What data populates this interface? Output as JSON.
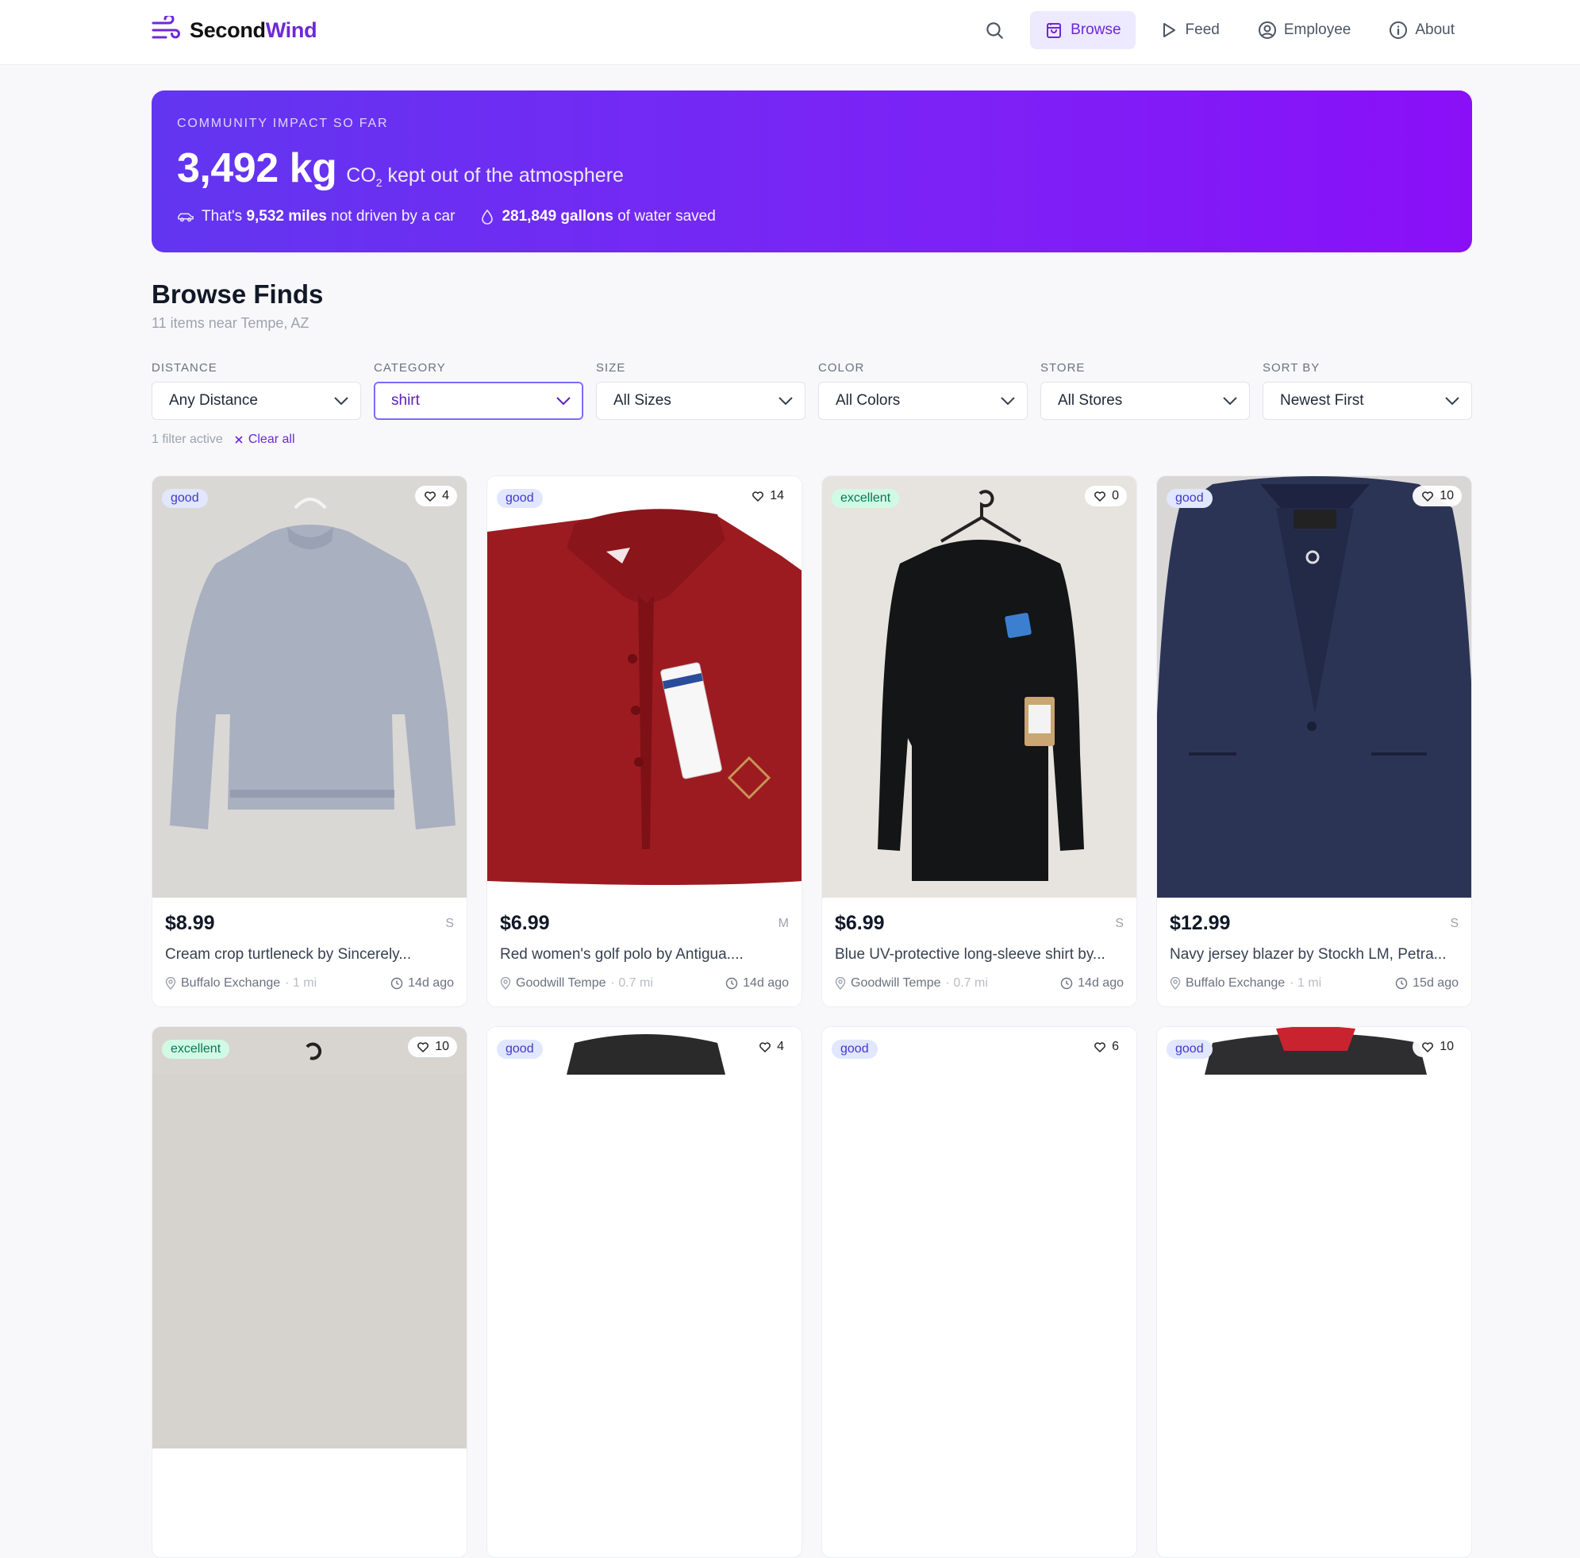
{
  "brand": {
    "name_part1": "Second",
    "name_part2": "Wind"
  },
  "nav": {
    "items": [
      {
        "label": "Browse",
        "icon": "shopping-bag-icon",
        "active": true
      },
      {
        "label": "Feed",
        "icon": "play-icon"
      },
      {
        "label": "Employee",
        "icon": "user-circle-icon"
      },
      {
        "label": "About",
        "icon": "info-icon"
      }
    ]
  },
  "impact": {
    "kicker": "COMMUNITY IMPACT SO FAR",
    "amount": "3,492 kg",
    "co2_prefix": "CO",
    "co2_sub": "2",
    "co2_suffix": " kept out of the atmosphere",
    "miles_prefix": "That's ",
    "miles_value": "9,532 miles",
    "miles_suffix": " not driven by a car",
    "water_value": "281,849 gallons",
    "water_suffix": " of water saved"
  },
  "heading": {
    "title": "Browse Finds",
    "count": "11 items near Tempe, AZ"
  },
  "filters": [
    {
      "label": "DISTANCE",
      "value": "Any Distance",
      "active": false
    },
    {
      "label": "CATEGORY",
      "value": "shirt",
      "active": true
    },
    {
      "label": "SIZE",
      "value": "All Sizes",
      "active": false
    },
    {
      "label": "COLOR",
      "value": "All Colors",
      "active": false
    },
    {
      "label": "STORE",
      "value": "All Stores",
      "active": false
    },
    {
      "label": "SORT BY",
      "value": "Newest First",
      "active": false
    }
  ],
  "filter_meta": {
    "active_text": "1 filter active",
    "clear_label": "Clear all"
  },
  "items": [
    {
      "condition": "good",
      "likes": "4",
      "price": "$8.99",
      "size": "S",
      "title": "Cream crop turtleneck by Sincerely...",
      "store": "Buffalo Exchange",
      "distance": "· 1 mi",
      "time": "14d ago"
    },
    {
      "condition": "good",
      "likes": "14",
      "price": "$6.99",
      "size": "M",
      "title": "Red women's golf polo by Antigua....",
      "store": "Goodwill Tempe",
      "distance": "· 0.7 mi",
      "time": "14d ago"
    },
    {
      "condition": "excellent",
      "likes": "0",
      "price": "$6.99",
      "size": "S",
      "title": "Blue UV-protective long-sleeve shirt by...",
      "store": "Goodwill Tempe",
      "distance": "· 0.7 mi",
      "time": "14d ago"
    },
    {
      "condition": "good",
      "likes": "10",
      "price": "$12.99",
      "size": "S",
      "title": "Navy jersey blazer by Stockh LM, Petra...",
      "store": "Buffalo Exchange",
      "distance": "· 1 mi",
      "time": "15d ago"
    },
    {
      "condition": "excellent",
      "likes": "10"
    },
    {
      "condition": "good",
      "likes": "4"
    },
    {
      "condition": "good",
      "likes": "6"
    },
    {
      "condition": "good",
      "likes": "10"
    }
  ]
}
